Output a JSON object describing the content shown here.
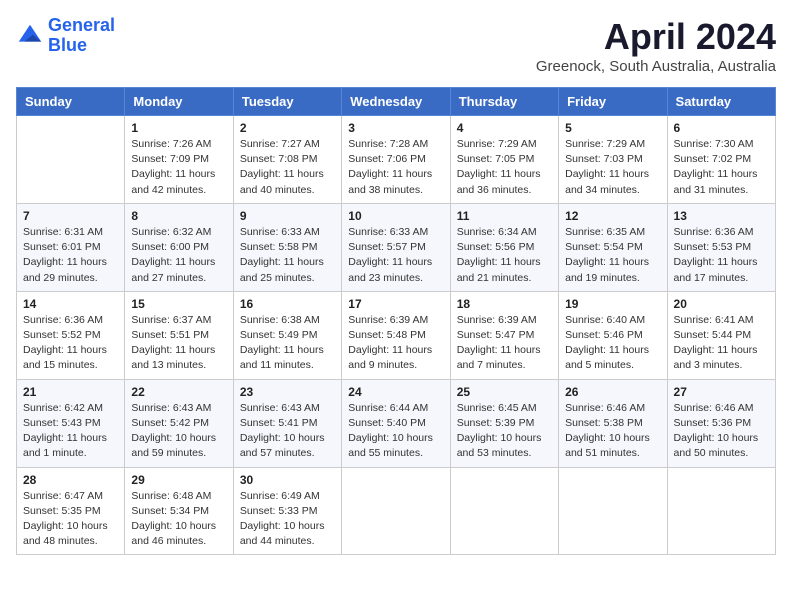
{
  "header": {
    "logo_line1": "General",
    "logo_line2": "Blue",
    "month": "April 2024",
    "location": "Greenock, South Australia, Australia"
  },
  "weekdays": [
    "Sunday",
    "Monday",
    "Tuesday",
    "Wednesday",
    "Thursday",
    "Friday",
    "Saturday"
  ],
  "weeks": [
    [
      {
        "day": "",
        "sunrise": "",
        "sunset": "",
        "daylight": ""
      },
      {
        "day": "1",
        "sunrise": "Sunrise: 7:26 AM",
        "sunset": "Sunset: 7:09 PM",
        "daylight": "Daylight: 11 hours and 42 minutes."
      },
      {
        "day": "2",
        "sunrise": "Sunrise: 7:27 AM",
        "sunset": "Sunset: 7:08 PM",
        "daylight": "Daylight: 11 hours and 40 minutes."
      },
      {
        "day": "3",
        "sunrise": "Sunrise: 7:28 AM",
        "sunset": "Sunset: 7:06 PM",
        "daylight": "Daylight: 11 hours and 38 minutes."
      },
      {
        "day": "4",
        "sunrise": "Sunrise: 7:29 AM",
        "sunset": "Sunset: 7:05 PM",
        "daylight": "Daylight: 11 hours and 36 minutes."
      },
      {
        "day": "5",
        "sunrise": "Sunrise: 7:29 AM",
        "sunset": "Sunset: 7:03 PM",
        "daylight": "Daylight: 11 hours and 34 minutes."
      },
      {
        "day": "6",
        "sunrise": "Sunrise: 7:30 AM",
        "sunset": "Sunset: 7:02 PM",
        "daylight": "Daylight: 11 hours and 31 minutes."
      }
    ],
    [
      {
        "day": "7",
        "sunrise": "Sunrise: 6:31 AM",
        "sunset": "Sunset: 6:01 PM",
        "daylight": "Daylight: 11 hours and 29 minutes."
      },
      {
        "day": "8",
        "sunrise": "Sunrise: 6:32 AM",
        "sunset": "Sunset: 6:00 PM",
        "daylight": "Daylight: 11 hours and 27 minutes."
      },
      {
        "day": "9",
        "sunrise": "Sunrise: 6:33 AM",
        "sunset": "Sunset: 5:58 PM",
        "daylight": "Daylight: 11 hours and 25 minutes."
      },
      {
        "day": "10",
        "sunrise": "Sunrise: 6:33 AM",
        "sunset": "Sunset: 5:57 PM",
        "daylight": "Daylight: 11 hours and 23 minutes."
      },
      {
        "day": "11",
        "sunrise": "Sunrise: 6:34 AM",
        "sunset": "Sunset: 5:56 PM",
        "daylight": "Daylight: 11 hours and 21 minutes."
      },
      {
        "day": "12",
        "sunrise": "Sunrise: 6:35 AM",
        "sunset": "Sunset: 5:54 PM",
        "daylight": "Daylight: 11 hours and 19 minutes."
      },
      {
        "day": "13",
        "sunrise": "Sunrise: 6:36 AM",
        "sunset": "Sunset: 5:53 PM",
        "daylight": "Daylight: 11 hours and 17 minutes."
      }
    ],
    [
      {
        "day": "14",
        "sunrise": "Sunrise: 6:36 AM",
        "sunset": "Sunset: 5:52 PM",
        "daylight": "Daylight: 11 hours and 15 minutes."
      },
      {
        "day": "15",
        "sunrise": "Sunrise: 6:37 AM",
        "sunset": "Sunset: 5:51 PM",
        "daylight": "Daylight: 11 hours and 13 minutes."
      },
      {
        "day": "16",
        "sunrise": "Sunrise: 6:38 AM",
        "sunset": "Sunset: 5:49 PM",
        "daylight": "Daylight: 11 hours and 11 minutes."
      },
      {
        "day": "17",
        "sunrise": "Sunrise: 6:39 AM",
        "sunset": "Sunset: 5:48 PM",
        "daylight": "Daylight: 11 hours and 9 minutes."
      },
      {
        "day": "18",
        "sunrise": "Sunrise: 6:39 AM",
        "sunset": "Sunset: 5:47 PM",
        "daylight": "Daylight: 11 hours and 7 minutes."
      },
      {
        "day": "19",
        "sunrise": "Sunrise: 6:40 AM",
        "sunset": "Sunset: 5:46 PM",
        "daylight": "Daylight: 11 hours and 5 minutes."
      },
      {
        "day": "20",
        "sunrise": "Sunrise: 6:41 AM",
        "sunset": "Sunset: 5:44 PM",
        "daylight": "Daylight: 11 hours and 3 minutes."
      }
    ],
    [
      {
        "day": "21",
        "sunrise": "Sunrise: 6:42 AM",
        "sunset": "Sunset: 5:43 PM",
        "daylight": "Daylight: 11 hours and 1 minute."
      },
      {
        "day": "22",
        "sunrise": "Sunrise: 6:43 AM",
        "sunset": "Sunset: 5:42 PM",
        "daylight": "Daylight: 10 hours and 59 minutes."
      },
      {
        "day": "23",
        "sunrise": "Sunrise: 6:43 AM",
        "sunset": "Sunset: 5:41 PM",
        "daylight": "Daylight: 10 hours and 57 minutes."
      },
      {
        "day": "24",
        "sunrise": "Sunrise: 6:44 AM",
        "sunset": "Sunset: 5:40 PM",
        "daylight": "Daylight: 10 hours and 55 minutes."
      },
      {
        "day": "25",
        "sunrise": "Sunrise: 6:45 AM",
        "sunset": "Sunset: 5:39 PM",
        "daylight": "Daylight: 10 hours and 53 minutes."
      },
      {
        "day": "26",
        "sunrise": "Sunrise: 6:46 AM",
        "sunset": "Sunset: 5:38 PM",
        "daylight": "Daylight: 10 hours and 51 minutes."
      },
      {
        "day": "27",
        "sunrise": "Sunrise: 6:46 AM",
        "sunset": "Sunset: 5:36 PM",
        "daylight": "Daylight: 10 hours and 50 minutes."
      }
    ],
    [
      {
        "day": "28",
        "sunrise": "Sunrise: 6:47 AM",
        "sunset": "Sunset: 5:35 PM",
        "daylight": "Daylight: 10 hours and 48 minutes."
      },
      {
        "day": "29",
        "sunrise": "Sunrise: 6:48 AM",
        "sunset": "Sunset: 5:34 PM",
        "daylight": "Daylight: 10 hours and 46 minutes."
      },
      {
        "day": "30",
        "sunrise": "Sunrise: 6:49 AM",
        "sunset": "Sunset: 5:33 PM",
        "daylight": "Daylight: 10 hours and 44 minutes."
      },
      {
        "day": "",
        "sunrise": "",
        "sunset": "",
        "daylight": ""
      },
      {
        "day": "",
        "sunrise": "",
        "sunset": "",
        "daylight": ""
      },
      {
        "day": "",
        "sunrise": "",
        "sunset": "",
        "daylight": ""
      },
      {
        "day": "",
        "sunrise": "",
        "sunset": "",
        "daylight": ""
      }
    ]
  ]
}
